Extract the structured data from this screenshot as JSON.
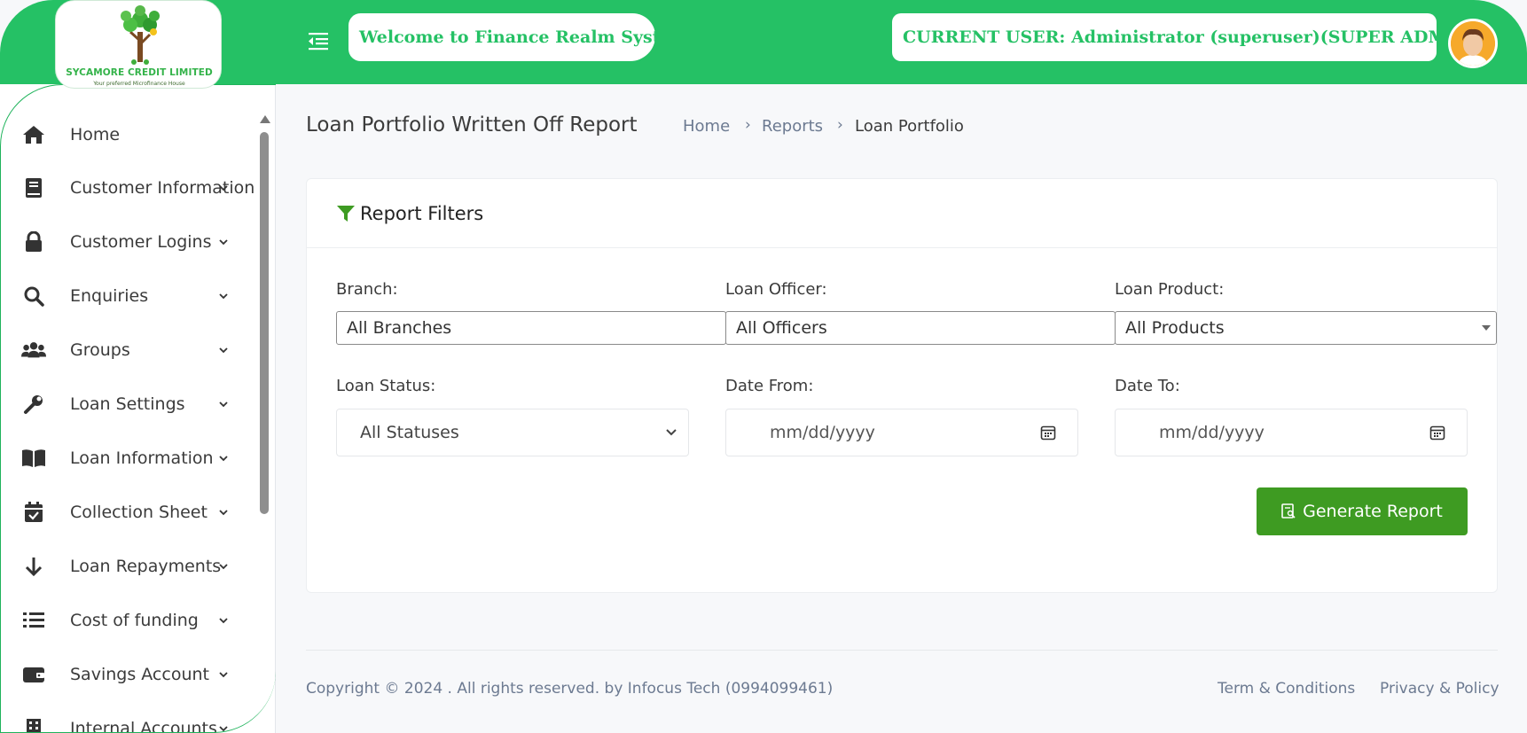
{
  "header": {
    "logo_name": "SYCAMORE CREDIT LIMITED",
    "logo_tagline": "Your preferred Microfinance House",
    "welcome": "Welcome to Finance Realm System",
    "current_user": "CURRENT USER: Administrator (superuser)(SUPER ADMIN)",
    "brand_color": "#25c165"
  },
  "sidebar": {
    "items": [
      {
        "label": "Home",
        "icon": "home-icon",
        "has_children": false
      },
      {
        "label": "Customer Information",
        "icon": "book-icon",
        "has_children": true
      },
      {
        "label": "Customer Logins",
        "icon": "lock-icon",
        "has_children": true
      },
      {
        "label": "Enquiries",
        "icon": "search-icon",
        "has_children": true
      },
      {
        "label": "Groups",
        "icon": "users-icon",
        "has_children": true
      },
      {
        "label": "Loan Settings",
        "icon": "wrench-icon",
        "has_children": true
      },
      {
        "label": "Loan Information",
        "icon": "open-book-icon",
        "has_children": true
      },
      {
        "label": "Collection Sheet",
        "icon": "calendar-check-icon",
        "has_children": true
      },
      {
        "label": "Loan Repayments",
        "icon": "arrow-down-icon",
        "has_children": true
      },
      {
        "label": "Cost of funding",
        "icon": "list-icon",
        "has_children": true
      },
      {
        "label": "Savings Account",
        "icon": "wallet-icon",
        "has_children": true
      },
      {
        "label": "Internal Accounts",
        "icon": "building-icon",
        "has_children": true
      }
    ]
  },
  "main": {
    "title": "Loan Portfolio Written Off Report",
    "breadcrumb": [
      "Home",
      "Reports",
      "Loan Portfolio"
    ],
    "card_title": "Report Filters",
    "filters": {
      "branch_label": "Branch:",
      "branch_value": "All Branches",
      "officer_label": "Loan Officer:",
      "officer_value": "All Officers",
      "product_label": "Loan Product:",
      "product_value": "All Products",
      "status_label": "Loan Status:",
      "status_value": "All Statuses",
      "date_from_label": "Date From:",
      "date_from_placeholder": "mm/dd/yyyy",
      "date_to_label": "Date To:",
      "date_to_placeholder": "mm/dd/yyyy"
    },
    "generate_button": "Generate Report",
    "button_color": "#3e9b22"
  },
  "footer": {
    "copyright": "Copyright © 2024 . All rights reserved. by Infocus Tech (0994099461)",
    "terms": "Term & Conditions",
    "privacy": "Privacy & Policy"
  }
}
